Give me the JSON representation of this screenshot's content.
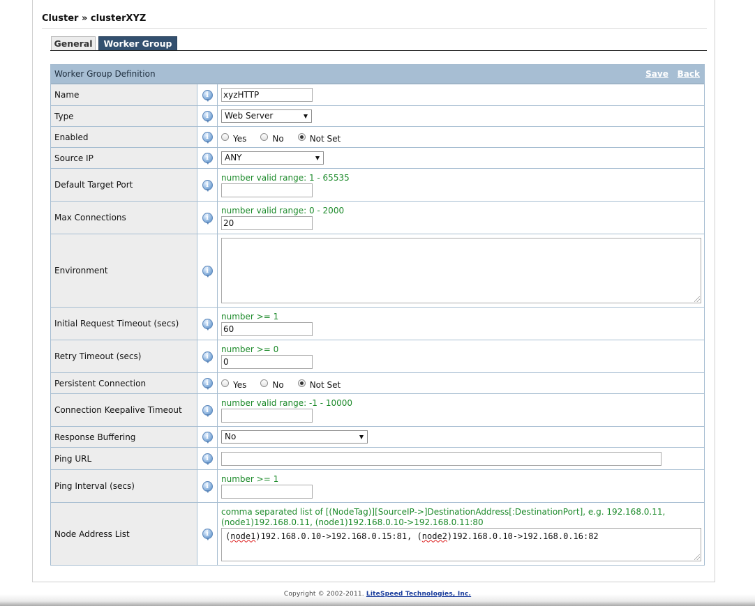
{
  "breadcrumb": "Cluster » clusterXYZ",
  "tabs": [
    {
      "label": "General",
      "active": false
    },
    {
      "label": "Worker Group",
      "active": true
    }
  ],
  "section": {
    "title": "Worker Group Definition",
    "save_label": "Save",
    "back_label": "Back"
  },
  "fields": {
    "name": {
      "label": "Name",
      "value": "xyzHTTP"
    },
    "type": {
      "label": "Type",
      "value": "Web Server"
    },
    "enabled": {
      "label": "Enabled",
      "options": [
        "Yes",
        "No",
        "Not Set"
      ],
      "selected": "Not Set"
    },
    "source_ip": {
      "label": "Source IP",
      "value": "ANY"
    },
    "default_target_port": {
      "label": "Default Target Port",
      "hint": "number valid range: 1 - 65535",
      "value": ""
    },
    "max_connections": {
      "label": "Max Connections",
      "hint": "number valid range: 0 - 2000",
      "value": "20"
    },
    "environment": {
      "label": "Environment",
      "value": ""
    },
    "initial_request_timeout": {
      "label": "Initial Request Timeout (secs)",
      "hint": "number >= 1",
      "value": "60"
    },
    "retry_timeout": {
      "label": "Retry Timeout (secs)",
      "hint": "number >= 0",
      "value": "0"
    },
    "persistent_connection": {
      "label": "Persistent Connection",
      "options": [
        "Yes",
        "No",
        "Not Set"
      ],
      "selected": "Not Set"
    },
    "keepalive_timeout": {
      "label": "Connection Keepalive Timeout",
      "hint": "number valid range: -1 - 10000",
      "value": ""
    },
    "response_buffering": {
      "label": "Response Buffering",
      "value": "No"
    },
    "ping_url": {
      "label": "Ping URL",
      "value": ""
    },
    "ping_interval": {
      "label": "Ping Interval (secs)",
      "hint": "number >= 1",
      "value": ""
    },
    "node_address_list": {
      "label": "Node Address List",
      "hint_line1": "comma separated list of [(NodeTag)][SourceIP->]DestinationAddress[:DestinationPort], e.g. 192.168.0.11,",
      "hint_line2": "(node1)192.168.0.11, (node1)192.168.0.10->192.168.0.11:80",
      "value_part1_open": "(",
      "value_tag1": "node1",
      "value_part1_rest": ")192.168.0.10->192.168.0.15:81, (",
      "value_tag2": "node2",
      "value_part2_rest": ")192.168.0.10->192.168.0.16:82"
    }
  },
  "footer": {
    "copyright": "Copyright © 2002-2011. ",
    "company": "LiteSpeed Technologies, Inc."
  }
}
